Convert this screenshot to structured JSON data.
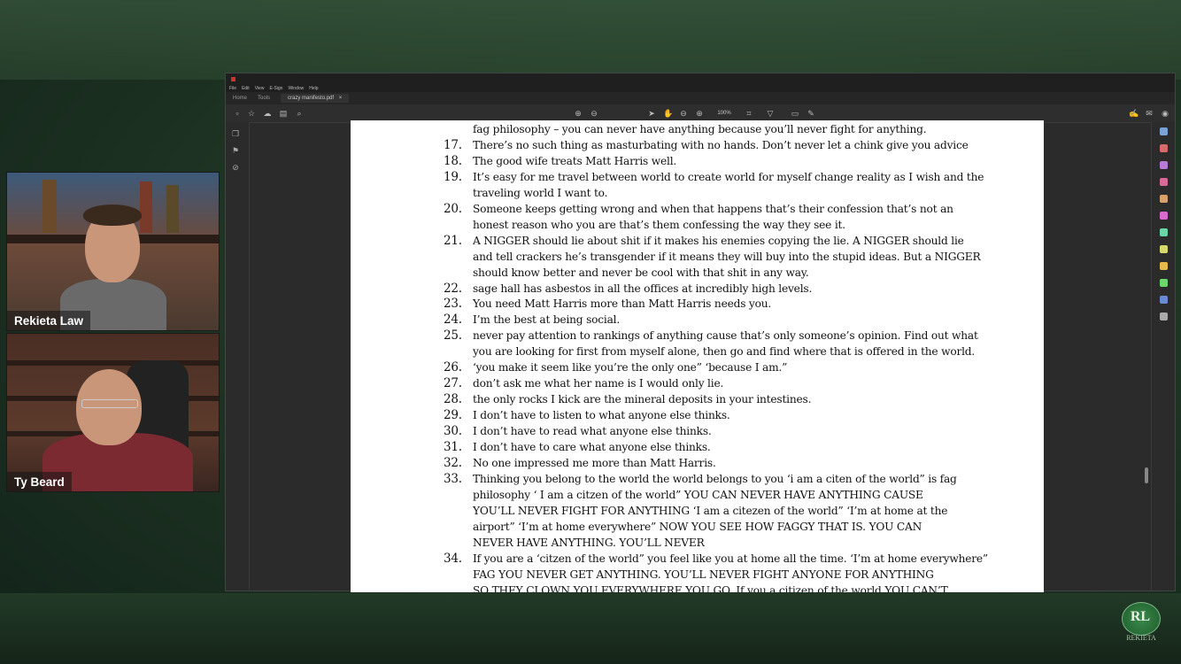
{
  "viewer": {
    "menu": [
      "File",
      "Edit",
      "View",
      "E-Sign",
      "Window",
      "Help"
    ],
    "tabs": {
      "home": "Home",
      "tools": "Tools",
      "document": "crazy manifesto.pdf"
    },
    "zoom": "100%"
  },
  "document": {
    "lines": [
      {
        "num": "",
        "text": "fag philosophy –  you can never have anything because you’ll never fight for anything."
      },
      {
        "num": "17.",
        "text": "There’s no such thing as masturbating with no hands. Don’t never let a chink give you advice"
      },
      {
        "num": "18.",
        "text": "The good wife treats Matt Harris well."
      },
      {
        "num": "19.",
        "text": "It’s easy for me travel between world to create world for myself change reality as I wish and the"
      },
      {
        "num": "",
        "text": "traveling world I want to."
      },
      {
        "num": "20.",
        "text": "Someone keeps getting wrong and when that happens that’s their confession that’s not an"
      },
      {
        "num": "",
        "text": "honest reason who you are that’s them confessing the way they see it."
      },
      {
        "num": "21.",
        "text": "A NIGGER should lie about shit if it makes his enemies copying the lie. A NIGGER should lie"
      },
      {
        "num": "",
        "text": "and tell crackers he’s transgender if it means they will buy into the stupid ideas. But a NIGGER"
      },
      {
        "num": "",
        "text": "should know better and never be cool with that shit in any way."
      },
      {
        "num": "22.",
        "text": "sage hall has asbestos in all the offices at incredibly high levels."
      },
      {
        "num": "23.",
        "text": "You need Matt Harris more than Matt Harris needs you."
      },
      {
        "num": "24.",
        "text": "I’m the best at being social."
      },
      {
        "num": "25.",
        "text": "never pay attention to rankings of anything cause that’s only someone’s opinion. Find out what"
      },
      {
        "num": "",
        "text": "you are looking for first from myself alone, then go and find where that is offered in the world."
      },
      {
        "num": "26.",
        "text": "‘you make it seem like you’re the only one” ‘because I am.”"
      },
      {
        "num": "27.",
        "text": "don’t ask me what her name is I would only lie."
      },
      {
        "num": "28.",
        "text": "the only rocks I kick are the mineral deposits in your intestines."
      },
      {
        "num": "29.",
        "text": "I don’t have to listen to what anyone else thinks."
      },
      {
        "num": "30.",
        "text": "I don’t have to read what anyone else thinks."
      },
      {
        "num": "31.",
        "text": "I don’t have to care what anyone else thinks."
      },
      {
        "num": "32.",
        "text": "No one impressed me more than Matt Harris."
      },
      {
        "num": "33.",
        "text": "Thinking you belong to the world the world belongs to you ‘i am a citen of the world” is fag"
      },
      {
        "num": "",
        "text": "philosophy ‘ I am a citzen of the world”   YOU CAN NEVER HAVE ANYTHING CAUSE"
      },
      {
        "num": "",
        "text": "YOU’LL NEVER FIGHT FOR ANYTHING ‘I am a citezen of the world” ‘I’m at home at the"
      },
      {
        "num": "",
        "text": "airport” ‘I’m at home everywhere” NOW YOU SEE HOW FAGGY THAT IS. YOU CAN"
      },
      {
        "num": "",
        "text": "NEVER HAVE ANYTHING. YOU’LL NEVER"
      },
      {
        "num": "34.",
        "text": "If you are a ‘citzen of the world” you feel like you at home all the time. ‘I’m at home everywhere”"
      },
      {
        "num": "",
        "text": "FAG YOU NEVER GET ANYTHING. YOU’LL NEVER FIGHT ANYONE FOR ANYTHING"
      },
      {
        "num": "",
        "text": "SO THEY CLOWN YOU EVERYWHERE YOU GO. If you a citizen of the world YOU CAN’T"
      }
    ]
  },
  "participants": {
    "top": "Rekieta Law",
    "bottom": "Ty Beard"
  },
  "logo": {
    "initials": "RL",
    "text": "REKIETA"
  }
}
